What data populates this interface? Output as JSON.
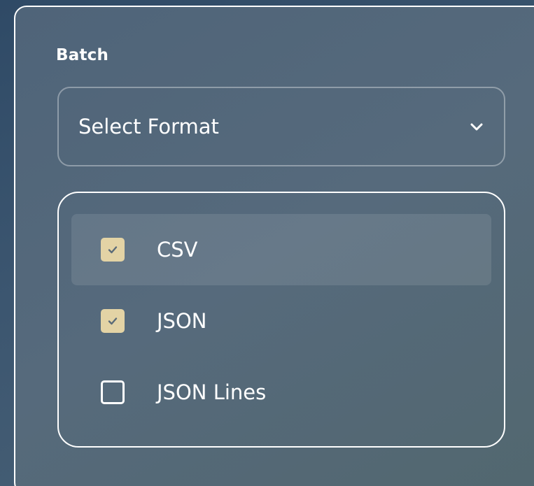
{
  "section": {
    "label": "Batch"
  },
  "select": {
    "placeholder": "Select Format",
    "icon": "chevron-down-icon"
  },
  "options": [
    {
      "label": "CSV",
      "checked": true,
      "highlighted": true
    },
    {
      "label": "JSON",
      "checked": true,
      "highlighted": false
    },
    {
      "label": "JSON Lines",
      "checked": false,
      "highlighted": false
    }
  ],
  "colors": {
    "checkbox_checked": "#e3d3a5",
    "checkmark": "#5b6b78",
    "border": "#ffffff"
  }
}
